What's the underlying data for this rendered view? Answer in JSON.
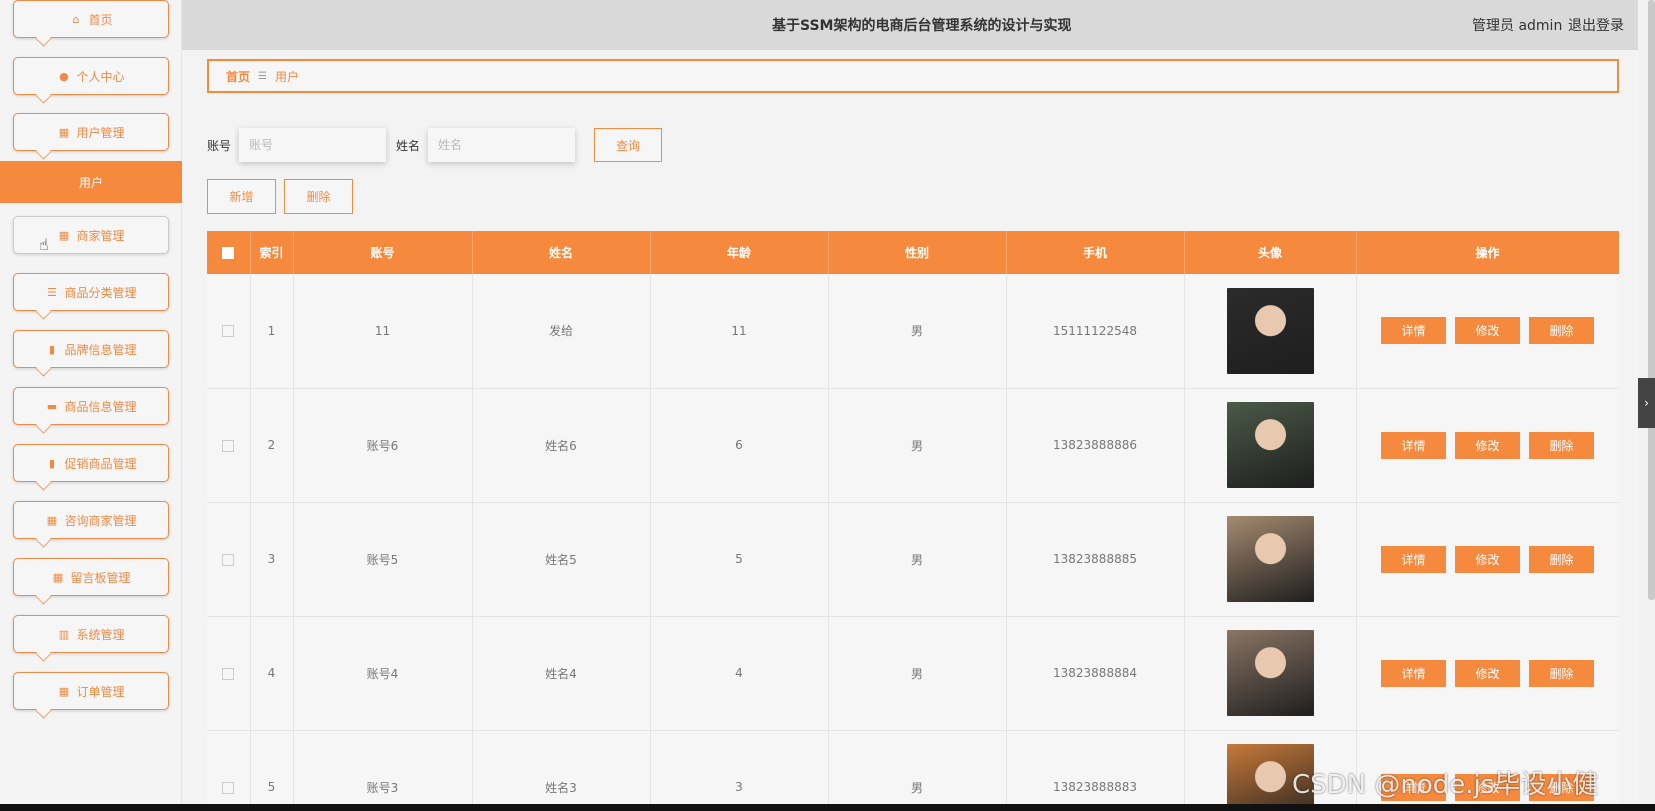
{
  "header": {
    "title": "基于SSM架构的电商后台管理系统的设计与实现",
    "admin": "管理员 admin",
    "logout": "退出登录"
  },
  "sidebar": {
    "items": [
      {
        "label": "首页",
        "icon": "home-icon"
      },
      {
        "label": "个人中心",
        "icon": "user-icon"
      },
      {
        "label": "用户管理",
        "icon": "grid-icon"
      },
      {
        "label": "商家管理",
        "icon": "grid-icon"
      },
      {
        "label": "商品分类管理",
        "icon": "list-icon"
      },
      {
        "label": "品牌信息管理",
        "icon": "clipboard-icon"
      },
      {
        "label": "商品信息管理",
        "icon": "box-icon"
      },
      {
        "label": "促销商品管理",
        "icon": "clipboard-check-icon"
      },
      {
        "label": "咨询商家管理",
        "icon": "grid-icon"
      },
      {
        "label": "留言板管理",
        "icon": "grid-icon"
      },
      {
        "label": "系统管理",
        "icon": "bar-chart-icon"
      },
      {
        "label": "订单管理",
        "icon": "grid-icon"
      }
    ],
    "active_sub": "用户"
  },
  "breadcrumb": {
    "home": "首页",
    "separator": "☰",
    "current": "用户"
  },
  "search": {
    "account_label": "账号",
    "account_placeholder": "账号",
    "name_label": "姓名",
    "name_placeholder": "姓名",
    "query_button": "查询"
  },
  "actions": {
    "add": "新增",
    "delete": "删除"
  },
  "table": {
    "headers": [
      "索引",
      "账号",
      "姓名",
      "年龄",
      "性别",
      "手机",
      "头像",
      "操作"
    ],
    "rows": [
      {
        "index": "1",
        "account": "11",
        "name": "发给",
        "age": "11",
        "gender": "男",
        "phone": "15111122548",
        "avatar_color": "#2b2b2b"
      },
      {
        "index": "2",
        "account": "账号6",
        "name": "姓名6",
        "age": "6",
        "gender": "男",
        "phone": "13823888886",
        "avatar_color": "#4a5a48"
      },
      {
        "index": "3",
        "account": "账号5",
        "name": "姓名5",
        "age": "5",
        "gender": "男",
        "phone": "13823888885",
        "avatar_color": "#a58a70"
      },
      {
        "index": "4",
        "account": "账号4",
        "name": "姓名4",
        "age": "4",
        "gender": "男",
        "phone": "13823888884",
        "avatar_color": "#8a7565"
      },
      {
        "index": "5",
        "account": "账号3",
        "name": "姓名3",
        "age": "3",
        "gender": "男",
        "phone": "13823888883",
        "avatar_color": "#c77a3a"
      }
    ],
    "row_actions": {
      "detail": "详情",
      "edit": "修改",
      "delete": "删除"
    }
  },
  "watermark": "CSDN @node.js毕设小健",
  "colors": {
    "accent": "#f58a3e",
    "header_bg": "#d9d9d9"
  }
}
